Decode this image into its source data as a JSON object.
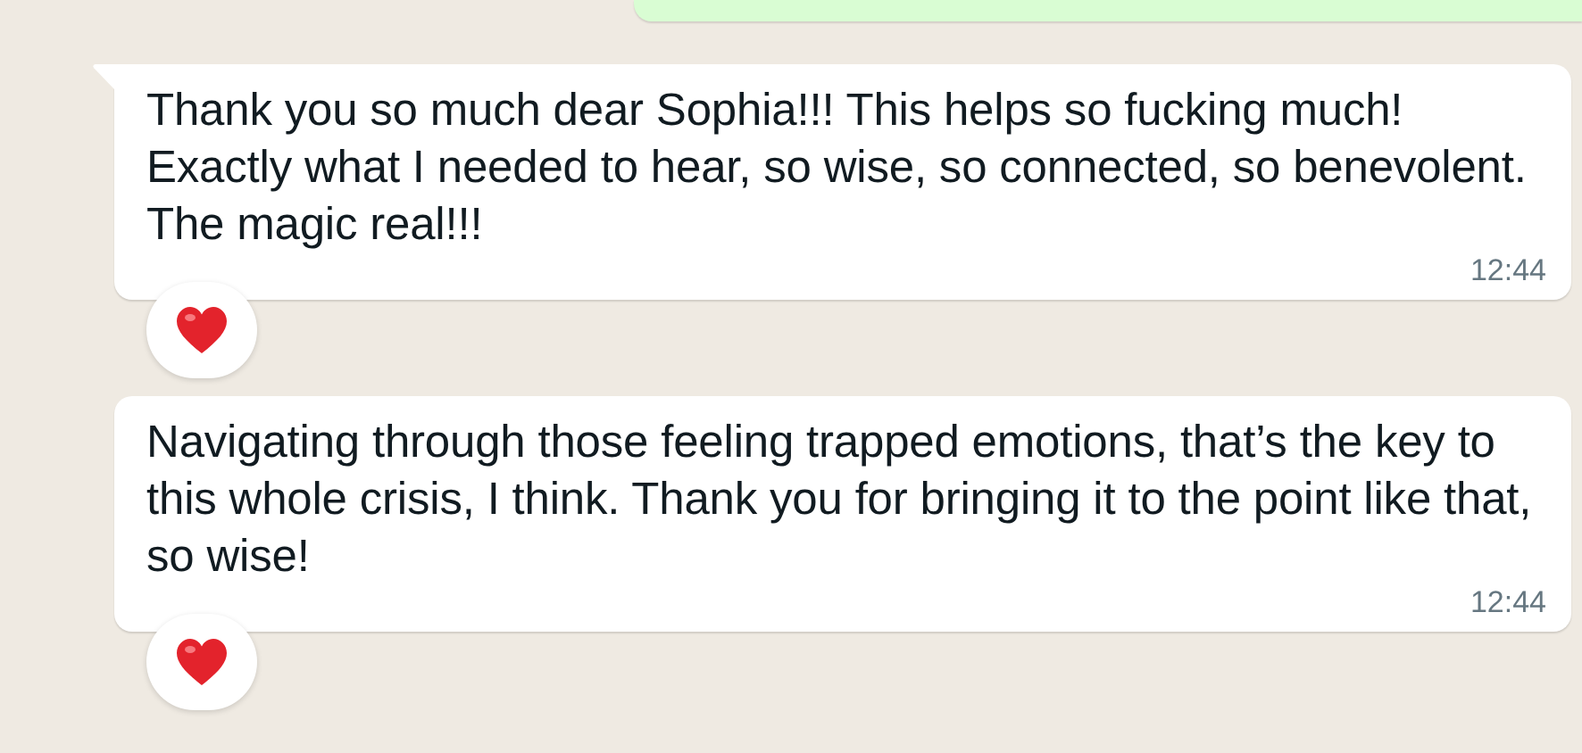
{
  "messages": [
    {
      "kind": "outgoing"
    },
    {
      "kind": "incoming",
      "text": "Thank you so much dear Sophia!!! This helps so fucking much! Exactly what I needed to hear, so wise, so connected, so benevolent. The magic real!!!",
      "time": "12:44",
      "tail": true,
      "reacted": true
    },
    {
      "kind": "incoming",
      "text": "Navigating through those feeling trapped emotions, that’s the key to this whole crisis, I think. Thank you for bringing it to the point like that, so wise!",
      "time": "12:44",
      "tail": false,
      "reacted": true
    }
  ]
}
